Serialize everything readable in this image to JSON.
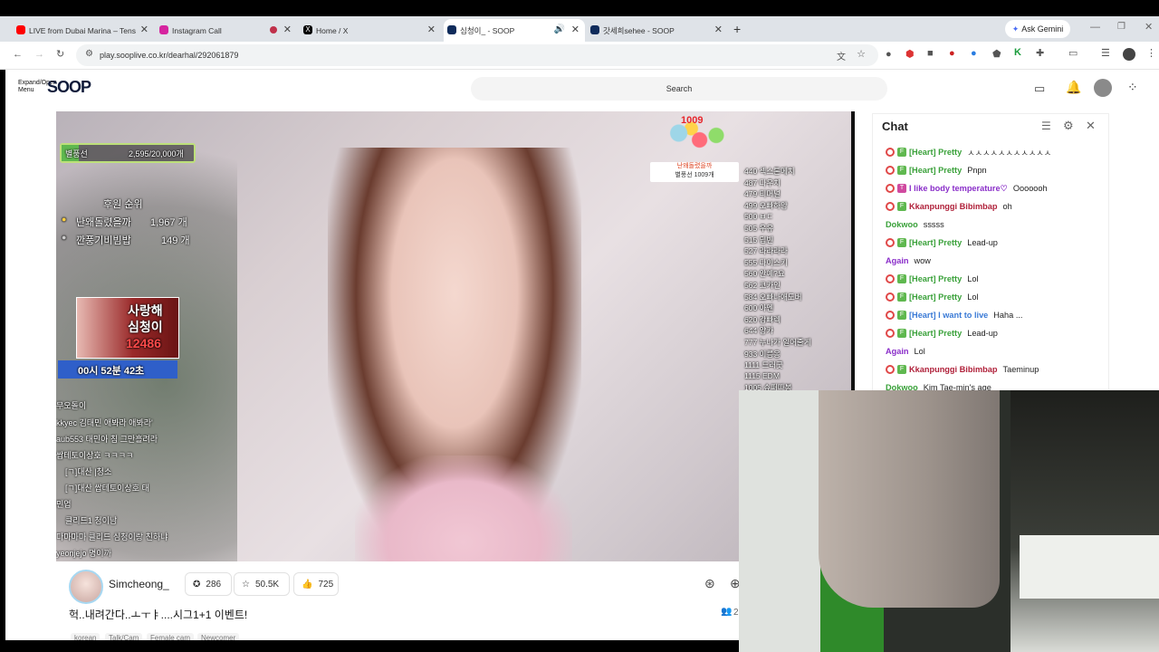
{
  "tabs": [
    {
      "title": "LIVE from Dubai Marina – Tens",
      "color": "#ff0000"
    },
    {
      "title": "Instagram Call",
      "color": "#d6249f"
    },
    {
      "title": "Home / X",
      "color": "#000000"
    },
    {
      "title": "심청이_ - SOOP",
      "color": "#0f2b5b"
    },
    {
      "title": "갓세희sehee - SOOP",
      "color": "#0f2b5b"
    }
  ],
  "new_tab": "+",
  "ask_gemini": "Ask Gemini",
  "url": "play.sooplive.co.kr/dearhal/292061879",
  "site": {
    "expand_menu": "Expand/Open Menu",
    "logo": "SOOP",
    "search_placeholder": "Search"
  },
  "stream": {
    "goal_label": "별풍선",
    "goal_value": "2,595/20,000개",
    "ranking_title": "후원 순위",
    "ranking": [
      {
        "rank": "1",
        "name": "난왜돌렸을까",
        "count": "1,967 개"
      },
      {
        "rank": "2",
        "name": "깐풍기비빔밥",
        "count": "149 개"
      }
    ],
    "promo_line1": "사랑해",
    "promo_line2": "심청이",
    "promo_num": "12486",
    "timer": "00시 52분 42초",
    "balloon_count": "1009",
    "balloon_name": "난왜돌렸을까",
    "balloon_sub": "별풍선 1009개",
    "donations": [
      "440 섹스톤메치",
      "487 다우치",
      "479 티머널",
      "499 오빠하앙",
      "500 ㅂㄷ",
      "505 우유",
      "515 딥빈",
      "527 라라라라",
      "555 다이스키",
      "560 안예?요",
      "562 코카인",
      "584 오빠나애도버",
      "600 아멘",
      "620 감빠렉",
      "644 양카",
      "777 누나가 일어줄게",
      "933 이름옹",
      "1111 드러굿",
      "1115 EDM",
      "1005 슈퍼따봉"
    ],
    "overlay_chat": [
      "무오돌이",
      "kkyec 김태민 애봐라 애봐라'",
      "aub553 태민아 침 그만흘려라",
      "쌉테토이상호 ㅋㅋㅋㅋ",
      "[ㄱ]대산 |청소",
      "[ㄱ]대산  쌉테토이상호 태",
      "민업",
      "클리드1 청이남",
      "다마마마 클리드 심청이랑 친하냐",
      "yeonjejo 명이까"
    ]
  },
  "chat": {
    "title": "Chat",
    "messages": [
      {
        "nick": "[Heart] Pretty",
        "text": "ㅅㅅㅅㅅㅅㅅㅅㅅㅅㅅㅅ",
        "color": "#3aa13a",
        "badge": "F"
      },
      {
        "nick": "[Heart] Pretty",
        "text": "Pnpn",
        "color": "#3aa13a",
        "badge": "F"
      },
      {
        "nick": "I like body temperature♡",
        "text": "Ooooooh",
        "color": "#8a2ec9",
        "badge": "T"
      },
      {
        "nick": "Kkanpunggi Bibimbap",
        "text": "oh",
        "color": "#b0213a",
        "badge": "F"
      },
      {
        "nick": "Dokwoo",
        "text": "sssss",
        "color": "#3aa13a",
        "badge": ""
      },
      {
        "nick": "[Heart] Pretty",
        "text": "Lead-up",
        "color": "#3aa13a",
        "badge": "F"
      },
      {
        "nick": "Again",
        "text": "wow",
        "color": "#8a2ec9",
        "badge": ""
      },
      {
        "nick": "[Heart] Pretty",
        "text": "Lol",
        "color": "#3aa13a",
        "badge": "F"
      },
      {
        "nick": "[Heart] Pretty",
        "text": "Lol",
        "color": "#3aa13a",
        "badge": "F"
      },
      {
        "nick": "[Heart] I want to live",
        "text": "Haha ...",
        "color": "#3a7ad6",
        "badge": "F"
      },
      {
        "nick": "[Heart] Pretty",
        "text": "Lead-up",
        "color": "#3aa13a",
        "badge": "F"
      },
      {
        "nick": "Again",
        "text": "Lol",
        "color": "#8a2ec9",
        "badge": ""
      },
      {
        "nick": "Kkanpunggi Bibimbap",
        "text": "Taeminup",
        "color": "#b0213a",
        "badge": "F"
      },
      {
        "nick": "Dokwoo",
        "text": "Kim Tae-min's age",
        "color": "#3aa13a",
        "badge": ""
      }
    ]
  },
  "info": {
    "streamer": "Simcheong_",
    "stat1": "286",
    "stat2": "50.5K",
    "stat3": "725",
    "title": "헉..내려간다..ㅗㅜㅑ....시그1+1 이벤트!",
    "tags": [
      "korean",
      "Talk/Cam",
      "Female cam",
      "Newcomer"
    ],
    "viewers": "2"
  }
}
